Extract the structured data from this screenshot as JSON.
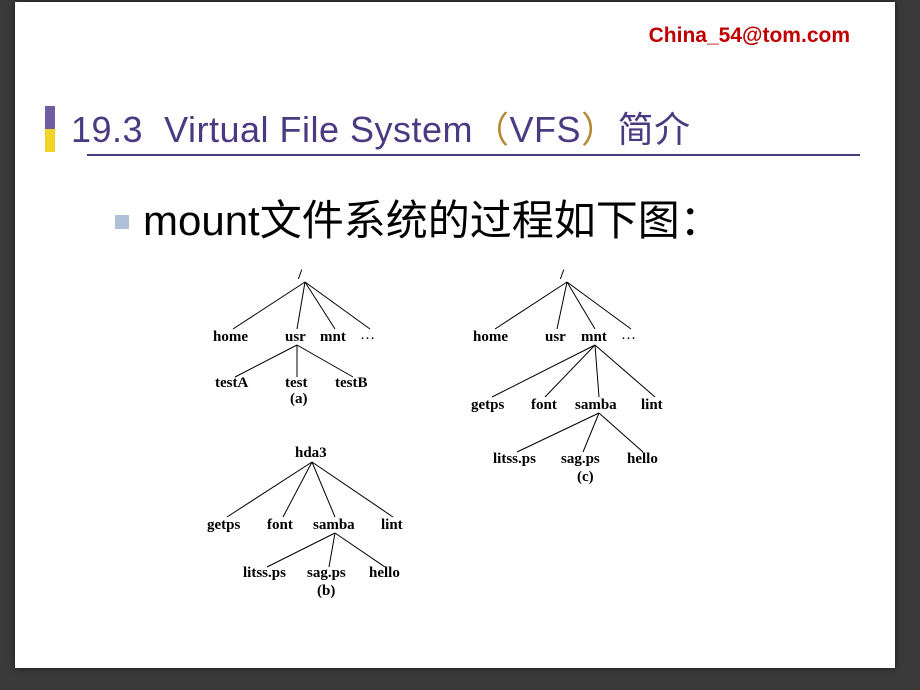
{
  "watermark": "China_54@tom.com",
  "title": {
    "num": "19.3",
    "main": "Virtual File System",
    "paren_open": "（",
    "abbr": "VFS",
    "paren_close": "）",
    "suffix": "简介"
  },
  "bullet": "mount文件系统的过程如下图：",
  "diagram": {
    "treeA": {
      "root": "/",
      "level1": [
        "home",
        "usr",
        "mnt",
        "…"
      ],
      "level2": [
        "testA",
        "test",
        "testB"
      ],
      "label": "(a)"
    },
    "treeB": {
      "root": "hda3",
      "level1": [
        "getps",
        "font",
        "samba",
        "lint"
      ],
      "level2": [
        "litss.ps",
        "sag.ps",
        "hello"
      ],
      "label": "(b)"
    },
    "treeC": {
      "root": "/",
      "level1": [
        "home",
        "usr",
        "mnt",
        "…"
      ],
      "level2": [
        "getps",
        "font",
        "samba",
        "lint"
      ],
      "level3": [
        "litss.ps",
        "sag.ps",
        "hello"
      ],
      "label": "(c)"
    }
  }
}
